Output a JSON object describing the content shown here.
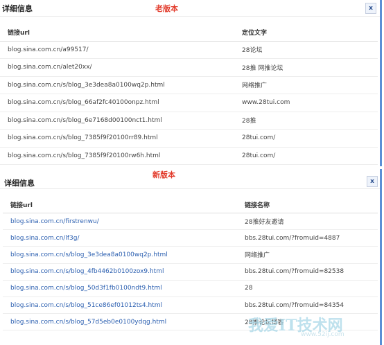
{
  "old_panel": {
    "title": "详细信息",
    "version_tag": "老版本",
    "close_label": "x",
    "columns": [
      "链接url",
      "定位文字"
    ],
    "rows": [
      [
        "blog.sina.com.cn/a99517/",
        "28论坛"
      ],
      [
        "blog.sina.com.cn/alet20xx/",
        "28推 网推论坛"
      ],
      [
        "blog.sina.com.cn/s/blog_3e3dea8a0100wq2p.html",
        "网络推广"
      ],
      [
        "blog.sina.com.cn/s/blog_66af2fc40100onpz.html",
        "www.28tui.com"
      ],
      [
        "blog.sina.com.cn/s/blog_6e7168d00100nct1.html",
        "28推"
      ],
      [
        "blog.sina.com.cn/s/blog_7385f9f20100rr89.html",
        "28tui.com/"
      ],
      [
        "blog.sina.com.cn/s/blog_7385f9f20100rw6h.html",
        "28tui.com/"
      ]
    ]
  },
  "new_panel": {
    "title": "详细信息",
    "version_tag": "新版本",
    "close_label": "x",
    "columns": [
      "链接url",
      "链接名称"
    ],
    "rows": [
      [
        "blog.sina.com.cn/firstrenwu/",
        "28推好友邀请"
      ],
      [
        "blog.sina.com.cn/lf3g/",
        "bbs.28tui.com/?fromuid=4887"
      ],
      [
        "blog.sina.com.cn/s/blog_3e3dea8a0100wq2p.html",
        "网络推广"
      ],
      [
        "blog.sina.com.cn/s/blog_4fb4462b0100zox9.html",
        "bbs.28tui.com/?fromuid=82538"
      ],
      [
        "blog.sina.com.cn/s/blog_50d3f1fb0100ndt9.html",
        "28"
      ],
      [
        "blog.sina.com.cn/s/blog_51ce86ef01012ts4.html",
        "bbs.28tui.com/?fromuid=84354"
      ],
      [
        "blog.sina.com.cn/s/blog_57d5eb0e0100ydqg.html",
        "28推论坛博客"
      ]
    ]
  },
  "watermark": {
    "text": "我爱IT技术网",
    "url": "www.52ij.com"
  },
  "colors": {
    "link": "#2b5fb0",
    "version_tag": "#e23a2a",
    "panel_border": "#5a8fd6"
  }
}
